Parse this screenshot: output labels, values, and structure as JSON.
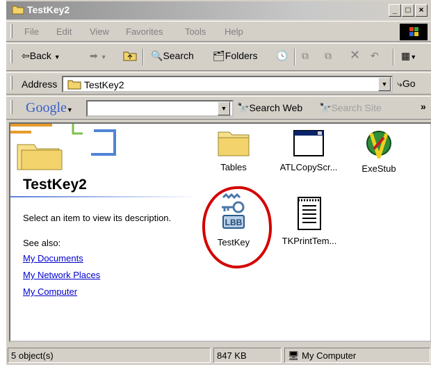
{
  "window": {
    "title": "TestKey2"
  },
  "menu": [
    "File",
    "Edit",
    "View",
    "Favorites",
    "Tools",
    "Help"
  ],
  "toolbar": {
    "back": "Back",
    "search": "Search",
    "folders": "Folders"
  },
  "address": {
    "label": "Address",
    "value": "TestKey2",
    "go": "Go"
  },
  "google": {
    "logo": "Google",
    "search_web": "Search Web",
    "search_site": "Search Site",
    "more": "»"
  },
  "panel": {
    "title": "TestKey2",
    "description": "Select an item to view its description.",
    "see_also": "See also:",
    "links": [
      "My Documents",
      "My Network Places",
      "My Computer"
    ]
  },
  "files": [
    {
      "name": "Tables",
      "icon": "folder-icon"
    },
    {
      "name": "ATLCopyScr...",
      "icon": "application-window-icon"
    },
    {
      "name": "ExeStub",
      "icon": "exestub-app-icon"
    },
    {
      "name": "TestKey",
      "icon": "testkey-key-icon"
    },
    {
      "name": "TKPrintTem...",
      "icon": "text-document-icon"
    }
  ],
  "status": {
    "objects": "5 object(s)",
    "size": "847 KB",
    "zone": "My Computer"
  },
  "colors": {
    "annotation": "#d40000",
    "link": "#0000cc",
    "chrome": "#d4d0c8"
  }
}
